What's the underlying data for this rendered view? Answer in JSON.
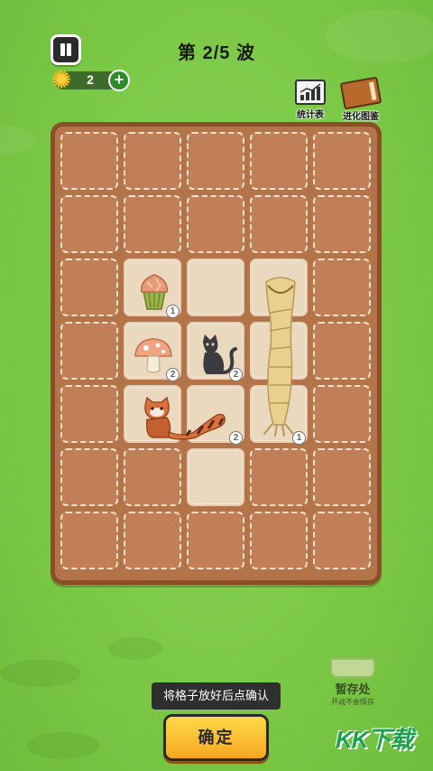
{
  "header": {
    "wave_title": "第 2/5 波",
    "sun_count": "2",
    "add_symbol": "+",
    "stats_label": "统计表",
    "evolution_book_label": "进化图鉴"
  },
  "board": {
    "units": [
      {
        "name": "cupcake-unit",
        "badge": "1"
      },
      {
        "name": "mushroom-unit",
        "badge": "2"
      },
      {
        "name": "black-cat-unit",
        "badge": "2"
      },
      {
        "name": "red-panda-unit",
        "badge": "2"
      },
      {
        "name": "worm-unit",
        "badge": "1"
      }
    ]
  },
  "footer": {
    "hint": "将格子放好后点确认",
    "confirm_label": "确定",
    "storage_title": "暂存处",
    "storage_subtitle": "开战不会保存"
  },
  "watermark": "KK下载",
  "colors": {
    "grass": "#7cc947",
    "board": "#b3744a",
    "board_border": "#8a4e29",
    "open_cell": "#ead8bf",
    "confirm_button": "#f5a81f"
  }
}
